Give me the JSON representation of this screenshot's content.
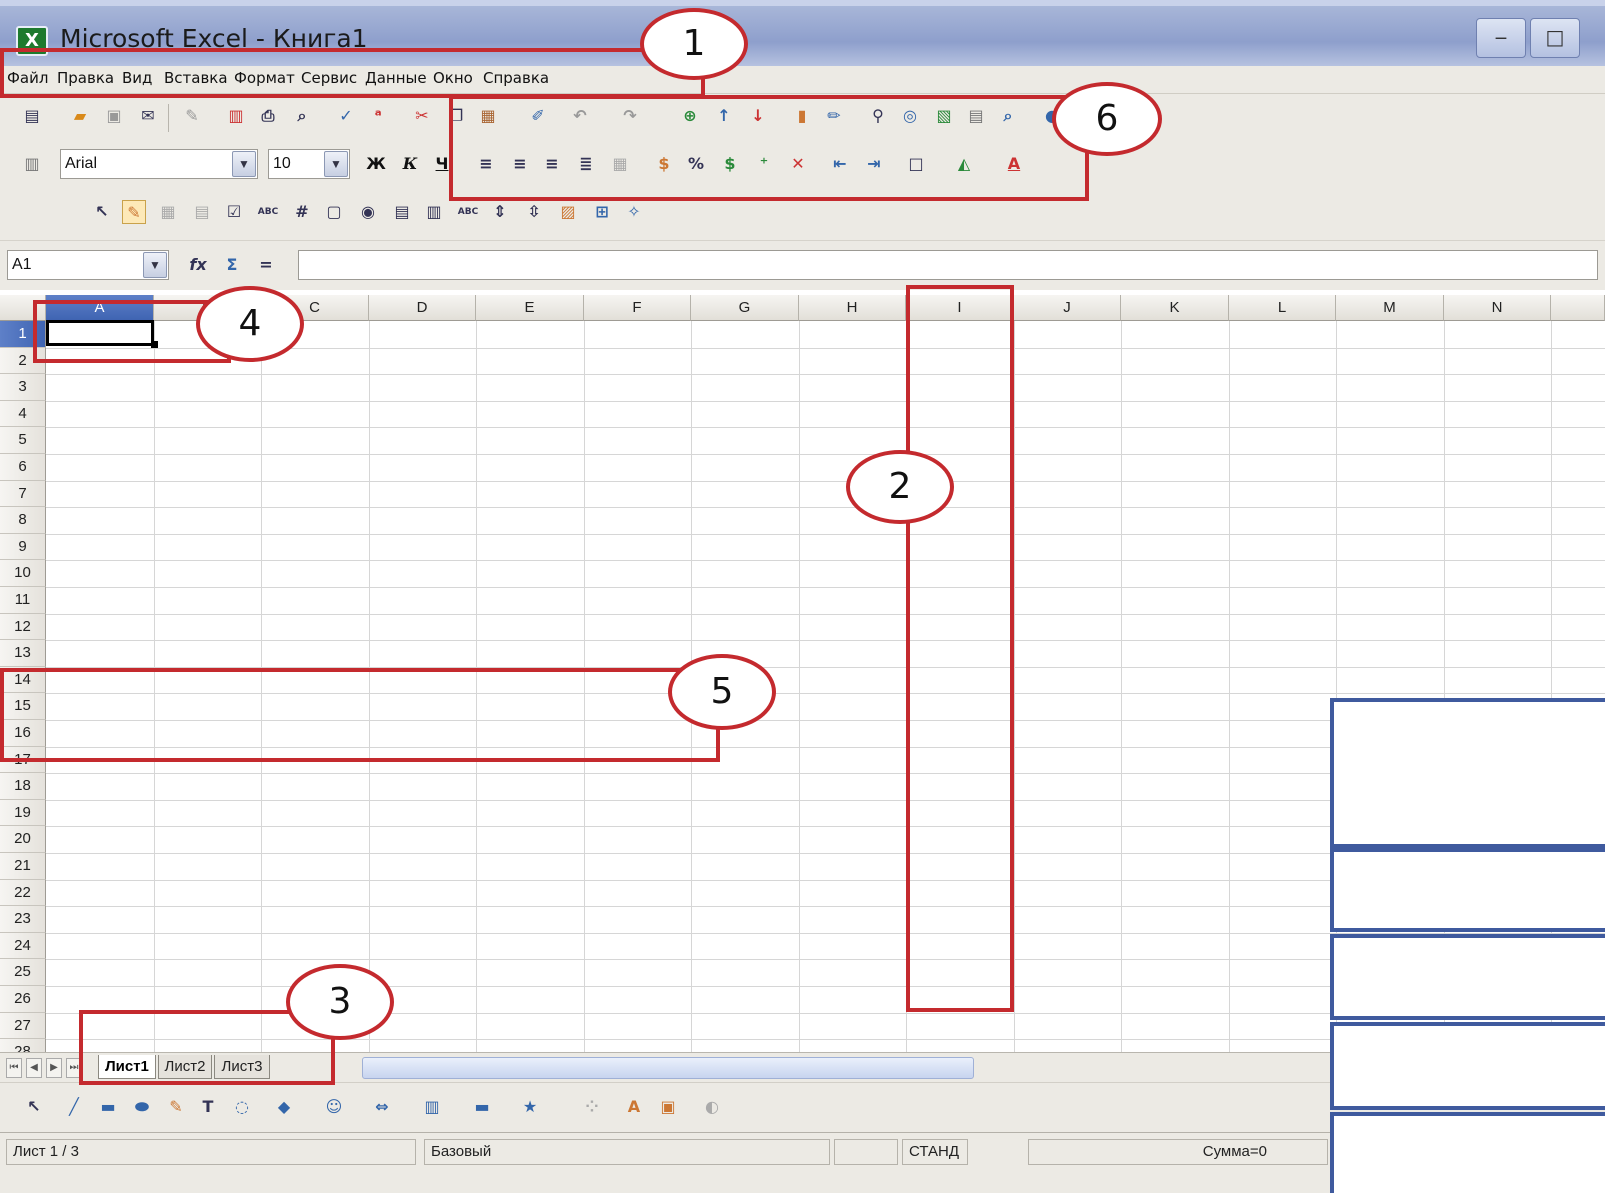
{
  "window": {
    "title": "Microsoft Excel - Книга1",
    "app_icon": "X",
    "minimize": "‒",
    "maximize": "□"
  },
  "menu": [
    "Файл",
    "Правка",
    "Вид",
    "Вставка",
    "Формат",
    "Сервис",
    "Данные",
    "Окно",
    "Справка"
  ],
  "format_toolbar": {
    "font": "Arial",
    "size": "10",
    "bold": "Ж",
    "italic": "К",
    "underline": "Ч"
  },
  "formula_bar": {
    "cell_ref": "A1",
    "function_wizard": "fx",
    "sum": "Σ",
    "equals": "="
  },
  "columns": [
    "A",
    "B",
    "C",
    "D",
    "E",
    "F",
    "G",
    "H",
    "I",
    "J",
    "K",
    "L",
    "M",
    "N"
  ],
  "rows": [
    "1",
    "2",
    "3",
    "4",
    "5",
    "6",
    "7",
    "8",
    "9",
    "10",
    "11",
    "12",
    "13",
    "14",
    "15",
    "16",
    "17",
    "18",
    "19",
    "20",
    "21",
    "22",
    "23",
    "24",
    "25",
    "26",
    "27",
    "28"
  ],
  "sheets": [
    "Лист1",
    "Лист2",
    "Лист3"
  ],
  "status": {
    "sheet": "Лист 1 / 3",
    "style": "Базовый",
    "mode": "СТАНД",
    "sum": "Сумма=0"
  },
  "callouts": [
    "1",
    "2",
    "3",
    "4",
    "5",
    "6"
  ],
  "colors": {
    "highlight": "#c42a2e",
    "panel_border": "#3f5a9e"
  }
}
